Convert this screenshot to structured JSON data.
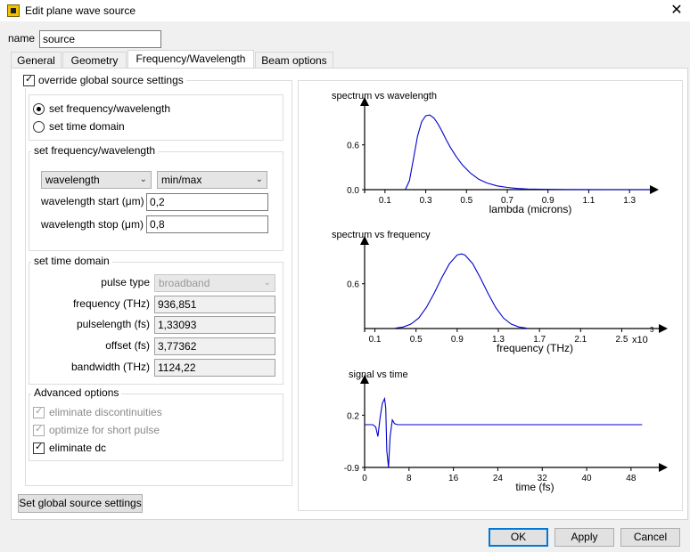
{
  "window": {
    "title": "Edit plane wave source",
    "close": "✕"
  },
  "name_field": {
    "label": "name",
    "value": "source"
  },
  "tabs": [
    {
      "label": "General"
    },
    {
      "label": "Geometry"
    },
    {
      "label": "Frequency/Wavelength"
    },
    {
      "label": "Beam options"
    }
  ],
  "override": {
    "label": "override global source settings",
    "checked": true
  },
  "mode": {
    "options": [
      {
        "label": "set frequency/wavelength",
        "selected": true
      },
      {
        "label": "set time domain",
        "selected": false
      }
    ]
  },
  "freq_group": {
    "title": "set frequency/wavelength",
    "unit_select": "wavelength",
    "range_select": "min/max",
    "start_label": "wavelength start (μm)",
    "start_value": "0,2",
    "stop_label": "wavelength stop (μm)",
    "stop_value": "0,8"
  },
  "time_group": {
    "title": "set time domain",
    "pulse_type_label": "pulse type",
    "pulse_type_value": "broadband",
    "frequency_label": "frequency (THz)",
    "frequency_value": "936,851",
    "pulselength_label": "pulselength (fs)",
    "pulselength_value": "1,33093",
    "offset_label": "offset (fs)",
    "offset_value": "3,77362",
    "bandwidth_label": "bandwidth (THz)",
    "bandwidth_value": "1124,22"
  },
  "advanced": {
    "title": "Advanced options",
    "items": [
      {
        "label": "eliminate discontinuities",
        "checked": true,
        "enabled": false
      },
      {
        "label": "optimize for short pulse",
        "checked": true,
        "enabled": false
      },
      {
        "label": "eliminate dc",
        "checked": true,
        "enabled": true
      }
    ]
  },
  "global_button": "Set global source settings",
  "footer": {
    "ok": "OK",
    "apply": "Apply",
    "cancel": "Cancel"
  },
  "colors": {
    "curve": "#0000cc",
    "accent": "#0078d7"
  },
  "chart_data": [
    {
      "type": "line",
      "title": "spectrum vs wavelength",
      "xlabel": "lambda (microns)",
      "ylabel": "",
      "xlim": [
        0.0,
        1.4
      ],
      "ylim": [
        0.0,
        1.05
      ],
      "x_ticks": [
        "0.1",
        "0.3",
        "0.5",
        "0.7",
        "0.9",
        "1.1",
        "1.3"
      ],
      "y_ticks": [
        "0.6",
        "0.0"
      ],
      "x": [
        0.2,
        0.22,
        0.24,
        0.26,
        0.28,
        0.3,
        0.32,
        0.34,
        0.36,
        0.38,
        0.4,
        0.42,
        0.45,
        0.48,
        0.52,
        0.56,
        0.6,
        0.65,
        0.7,
        0.75,
        0.8,
        0.9,
        1.0,
        1.2,
        1.4
      ],
      "y": [
        0.0,
        0.12,
        0.42,
        0.72,
        0.91,
        0.99,
        1.0,
        0.96,
        0.88,
        0.78,
        0.67,
        0.57,
        0.44,
        0.33,
        0.22,
        0.14,
        0.09,
        0.05,
        0.03,
        0.015,
        0.008,
        0.003,
        0.001,
        0.0,
        0.0
      ]
    },
    {
      "type": "line",
      "title": "spectrum vs frequency",
      "xlabel": "frequency (THz)",
      "ylabel": "",
      "x_multiplier": "x10^3",
      "xlim": [
        0.0,
        1.9
      ],
      "ylim": [
        0.0,
        1.05
      ],
      "x_ticks": [
        "0.1",
        "0.5",
        "0.9",
        "1.3",
        "1.7",
        "2.1",
        "2.5"
      ],
      "y_ticks": [
        "0.6"
      ],
      "x": [
        0.3,
        0.375,
        0.45,
        0.525,
        0.6,
        0.675,
        0.75,
        0.825,
        0.9,
        0.94,
        0.975,
        1.05,
        1.125,
        1.2,
        1.275,
        1.35,
        1.425,
        1.5,
        1.575
      ],
      "y": [
        0.005,
        0.02,
        0.06,
        0.14,
        0.28,
        0.47,
        0.68,
        0.87,
        0.985,
        1.0,
        0.985,
        0.87,
        0.68,
        0.47,
        0.28,
        0.14,
        0.06,
        0.02,
        0.005
      ]
    },
    {
      "type": "line",
      "title": "signal vs time",
      "xlabel": "time (fs)",
      "ylabel": "",
      "xlim": [
        0,
        52
      ],
      "ylim": [
        -0.9,
        0.75
      ],
      "x_ticks": [
        "0",
        "8",
        "16",
        "24",
        "32",
        "40",
        "48"
      ],
      "y_ticks": [
        "0.2",
        "-0.9"
      ],
      "x": [
        0,
        1.5,
        2.0,
        2.4,
        2.8,
        3.2,
        3.6,
        3.8,
        4.0,
        4.3,
        4.6,
        5.0,
        5.4,
        6.0,
        50
      ],
      "y": [
        0.0,
        0.0,
        -0.05,
        -0.25,
        0.15,
        0.45,
        0.55,
        0.35,
        -0.55,
        -0.9,
        -0.25,
        0.1,
        0.02,
        0.0,
        0.0
      ]
    }
  ]
}
